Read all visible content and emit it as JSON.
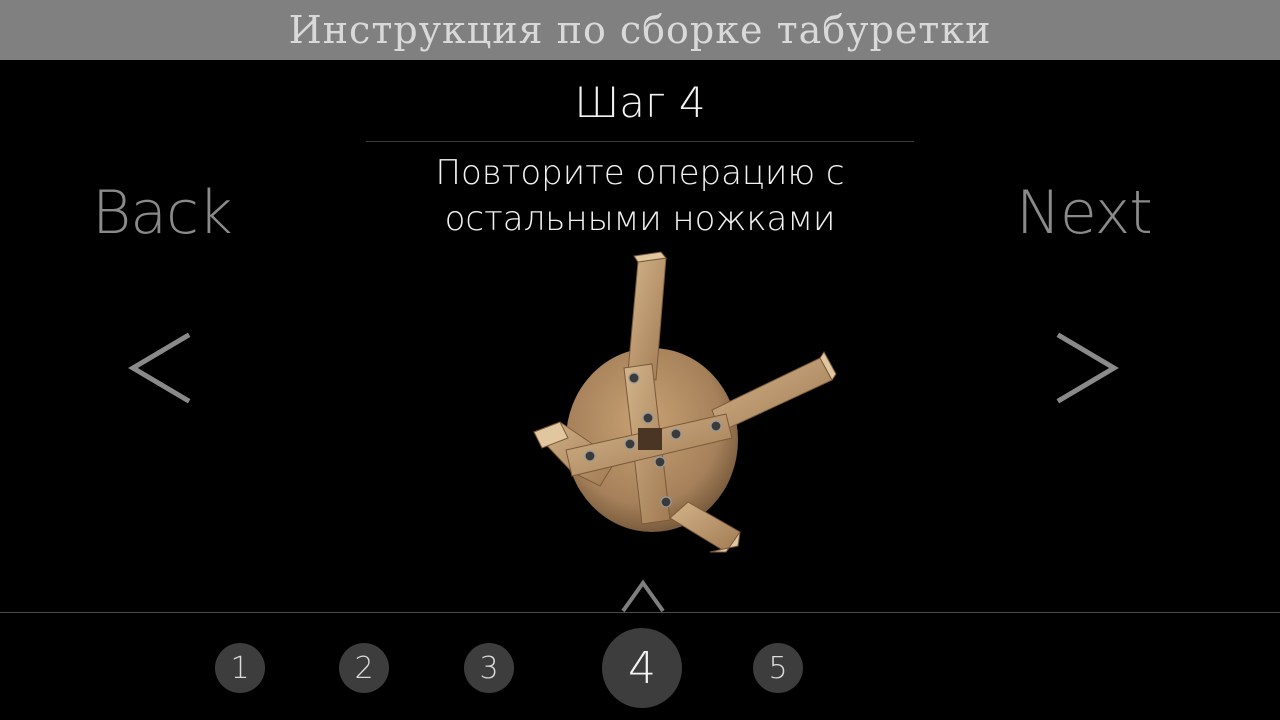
{
  "header": {
    "title": "Инструкция по сборке табуретки"
  },
  "step": {
    "title": "Шаг 4",
    "description_line1": "Повторите операцию с",
    "description_line2": "остальными ножками"
  },
  "nav": {
    "back_label": "Back",
    "next_label": "Next"
  },
  "pages": [
    "1",
    "2",
    "3",
    "4",
    "5"
  ],
  "current_page": 4,
  "icons": {
    "back": "chevron-left-icon",
    "next": "chevron-right-icon",
    "expand": "chevron-up-icon"
  },
  "colors": {
    "header_bg": "#808080",
    "header_text": "#d9d9d9",
    "background": "#000000",
    "nav_text": "#8a8a8a",
    "page_dot": "#3d3d3d",
    "wood_light": "#c9a77d",
    "wood_dark": "#8d6b48"
  }
}
